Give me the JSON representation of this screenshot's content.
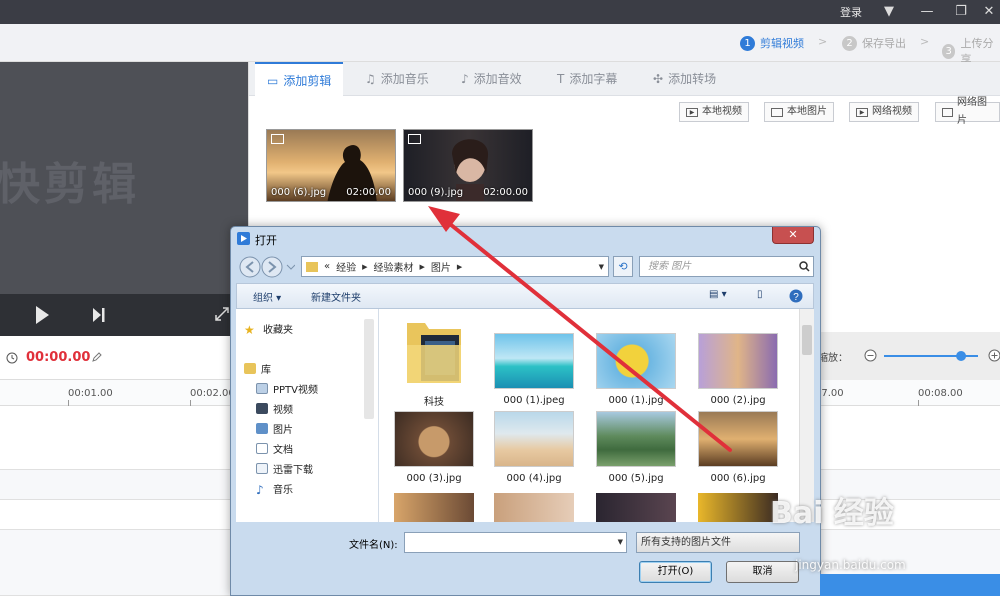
{
  "topbar": {
    "login": "登录"
  },
  "steps": [
    {
      "num": "1",
      "label": "剪辑视频"
    },
    {
      "num": "2",
      "label": "保存导出"
    },
    {
      "num": "3",
      "label": "上传分享"
    }
  ],
  "preview": {
    "watermark": "快剪辑"
  },
  "time": {
    "current": "00:00.00"
  },
  "tabs": [
    {
      "label": "添加剪辑"
    },
    {
      "label": "添加音乐"
    },
    {
      "label": "添加音效"
    },
    {
      "label": "添加字幕"
    },
    {
      "label": "添加转场"
    }
  ],
  "sources": [
    {
      "label": "本地视频"
    },
    {
      "label": "本地图片"
    },
    {
      "label": "网络视频"
    },
    {
      "label": "网络图片"
    }
  ],
  "clips": [
    {
      "name": "000 (6).jpg",
      "duration": "02:00.00"
    },
    {
      "name": "000 (9).jpg",
      "duration": "02:00.00"
    }
  ],
  "zoom": {
    "label": "缩放：",
    "level": 0.82
  },
  "ruler": [
    "00:01.00",
    "00:02.00",
    ":7.00",
    "00:08.00"
  ],
  "dialog": {
    "title": "打开",
    "path": [
      "经验",
      "经验素材",
      "图片"
    ],
    "search_placeholder": "搜索 图片",
    "organize": "组织",
    "new_folder": "新建文件夹",
    "nav": [
      "收藏夹",
      "库",
      "PPTV视频",
      "视频",
      "图片",
      "文档",
      "迅雷下载",
      "音乐"
    ],
    "files": [
      {
        "name": "科技"
      },
      {
        "name": "000 (1).jpeg"
      },
      {
        "name": "000 (1).jpg"
      },
      {
        "name": "000 (2).jpg"
      },
      {
        "name": "000 (3).jpg"
      },
      {
        "name": "000 (4).jpg"
      },
      {
        "name": "000 (5).jpg"
      },
      {
        "name": "000 (6).jpg"
      }
    ],
    "filename_label": "文件名(N):",
    "filename_value": "",
    "filter": "所有支持的图片文件",
    "open_button": "打开(O)",
    "cancel_button": "取消"
  },
  "watermark": {
    "brand": "Bai 经验",
    "url": "jingyan.baidu.com"
  },
  "colors": {
    "accent": "#2f7bd8",
    "arrow": "#e0303a",
    "time": "#e0303a"
  }
}
